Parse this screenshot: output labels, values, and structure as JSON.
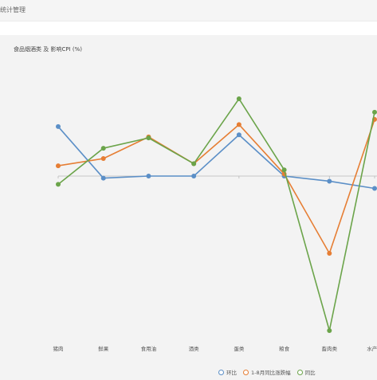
{
  "window": {
    "title": "统计管理"
  },
  "chart_data": {
    "type": "line",
    "title": "食品烟酒类 及 影响CPI (%)",
    "categories": [
      "猪肉",
      "鲜果",
      "食用油",
      "酒类",
      "蛋类",
      "粮食",
      "畜肉类",
      "水产品"
    ],
    "ylim": [
      -1.5,
      1.5
    ],
    "baseline": 0,
    "grid": false,
    "legend_position": "bottom-right",
    "series": [
      {
        "name": "环比",
        "color": "#5b8fc7",
        "values": [
          0.48,
          -0.02,
          0.0,
          0.0,
          0.4,
          0.0,
          -0.05,
          -0.12
        ]
      },
      {
        "name": "1-8月同比涨跌幅",
        "color": "#e67e34",
        "values": [
          0.1,
          0.17,
          0.38,
          0.12,
          0.5,
          0.02,
          -0.75,
          0.55
        ]
      },
      {
        "name": "同比",
        "color": "#6ba44a",
        "values": [
          -0.08,
          0.27,
          0.37,
          0.12,
          0.75,
          0.06,
          -1.5,
          0.62
        ]
      }
    ]
  }
}
